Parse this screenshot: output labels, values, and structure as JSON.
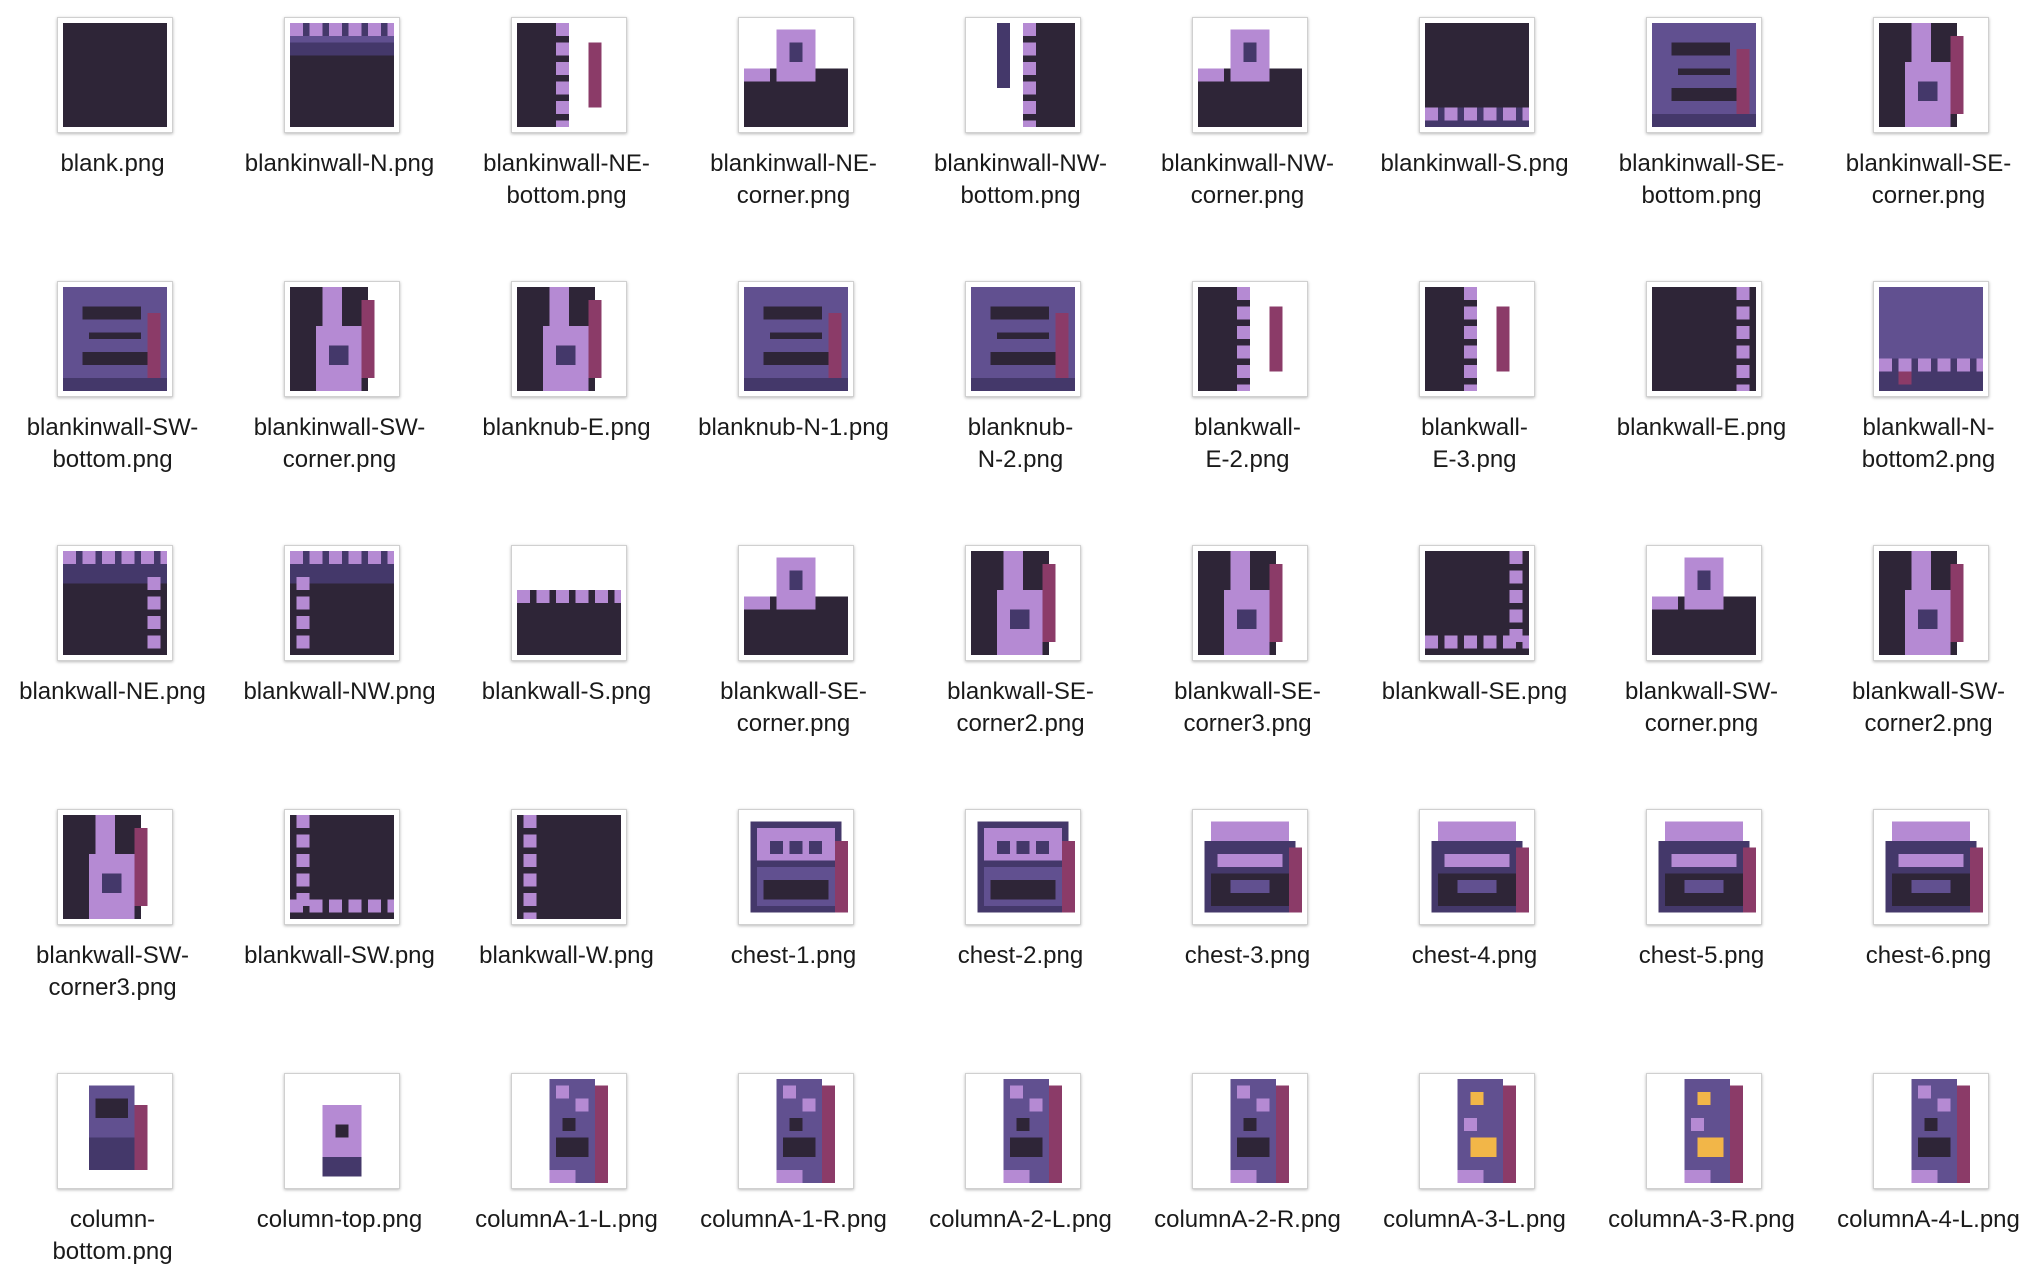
{
  "colors": {
    "dark": "#2e2537",
    "wall": "#615090",
    "wall_dark": "#44386a",
    "light": "#b58ad3",
    "accent": "#8b3b68",
    "gold": "#f2b648"
  },
  "files": [
    {
      "name": "blank.png",
      "label_lines": [
        "blank.png"
      ],
      "pattern": "dark"
    },
    {
      "name": "blankinwall-N.png",
      "label_lines": [
        "blankinwall-N.png"
      ],
      "pattern": "wall-top"
    },
    {
      "name": "blankinwall-NE-bottom.png",
      "label_lines": [
        "blankinwall-NE-",
        "bottom.png"
      ],
      "pattern": "wall-right-side"
    },
    {
      "name": "blankinwall-NE-corner.png",
      "label_lines": [
        "blankinwall-NE-",
        "corner.png"
      ],
      "pattern": "corner-nub"
    },
    {
      "name": "blankinwall-NW-bottom.png",
      "label_lines": [
        "blankinwall-NW-",
        "bottom.png"
      ],
      "pattern": "wall-left-side"
    },
    {
      "name": "blankinwall-NW-corner.png",
      "label_lines": [
        "blankinwall-NW-",
        "corner.png"
      ],
      "pattern": "corner-nub"
    },
    {
      "name": "blankinwall-S.png",
      "label_lines": [
        "blankinwall-S.png"
      ],
      "pattern": "wall-bottom"
    },
    {
      "name": "blankinwall-SE-bottom.png",
      "label_lines": [
        "blankinwall-SE-",
        "bottom.png"
      ],
      "pattern": "nub-block"
    },
    {
      "name": "blankinwall-SE-corner.png",
      "label_lines": [
        "blankinwall-SE-",
        "corner.png"
      ],
      "pattern": "column-piece"
    },
    {
      "name": "blankinwall-SW-bottom.png",
      "label_lines": [
        "blankinwall-SW-",
        "bottom.png"
      ],
      "pattern": "nub-block"
    },
    {
      "name": "blankinwall-SW-corner.png",
      "label_lines": [
        "blankinwall-SW-",
        "corner.png"
      ],
      "pattern": "column-piece"
    },
    {
      "name": "blanknub-E.png",
      "label_lines": [
        "blanknub-E.png"
      ],
      "pattern": "column-piece"
    },
    {
      "name": "blanknub-N-1.png",
      "label_lines": [
        "blanknub-N-1.png"
      ],
      "pattern": "nub-block"
    },
    {
      "name": "blanknub-N-2.png",
      "label_lines": [
        "blanknub-",
        "N-2.png"
      ],
      "pattern": "nub-block"
    },
    {
      "name": "blankwall-E-2.png",
      "label_lines": [
        "blankwall-",
        "E-2.png"
      ],
      "pattern": "wall-right-side"
    },
    {
      "name": "blankwall-E-3.png",
      "label_lines": [
        "blankwall-",
        "E-3.png"
      ],
      "pattern": "wall-right-side"
    },
    {
      "name": "blankwall-E.png",
      "label_lines": [
        "blankwall-E.png"
      ],
      "pattern": "wall-right"
    },
    {
      "name": "blankwall-N-bottom2.png",
      "label_lines": [
        "blankwall-N-",
        "bottom2.png"
      ],
      "pattern": "wall-block"
    },
    {
      "name": "blankwall-NE.png",
      "label_lines": [
        "blankwall-NE.png"
      ],
      "pattern": "wall-top-right"
    },
    {
      "name": "blankwall-NW.png",
      "label_lines": [
        "blankwall-NW.png"
      ],
      "pattern": "wall-top-left"
    },
    {
      "name": "blankwall-S.png",
      "label_lines": [
        "blankwall-S.png"
      ],
      "pattern": "wall-low"
    },
    {
      "name": "blankwall-SE-corner.png",
      "label_lines": [
        "blankwall-SE-",
        "corner.png"
      ],
      "pattern": "corner-nub"
    },
    {
      "name": "blankwall-SE-corner2.png",
      "label_lines": [
        "blankwall-SE-",
        "corner2.png"
      ],
      "pattern": "column-piece"
    },
    {
      "name": "blankwall-SE-corner3.png",
      "label_lines": [
        "blankwall-SE-",
        "corner3.png"
      ],
      "pattern": "column-piece"
    },
    {
      "name": "blankwall-SE.png",
      "label_lines": [
        "blankwall-SE.png"
      ],
      "pattern": "wall-bottom-right"
    },
    {
      "name": "blankwall-SW-corner.png",
      "label_lines": [
        "blankwall-SW-",
        "corner.png"
      ],
      "pattern": "corner-nub"
    },
    {
      "name": "blankwall-SW-corner2.png",
      "label_lines": [
        "blankwall-SW-",
        "corner2.png"
      ],
      "pattern": "column-piece"
    },
    {
      "name": "blankwall-SW-corner3.png",
      "label_lines": [
        "blankwall-SW-",
        "corner3.png"
      ],
      "pattern": "column-piece"
    },
    {
      "name": "blankwall-SW.png",
      "label_lines": [
        "blankwall-SW.png"
      ],
      "pattern": "wall-bottom-left"
    },
    {
      "name": "blankwall-W.png",
      "label_lines": [
        "blankwall-W.png"
      ],
      "pattern": "wall-left"
    },
    {
      "name": "chest-1.png",
      "label_lines": [
        "chest-1.png"
      ],
      "pattern": "chest"
    },
    {
      "name": "chest-2.png",
      "label_lines": [
        "chest-2.png"
      ],
      "pattern": "chest"
    },
    {
      "name": "chest-3.png",
      "label_lines": [
        "chest-3.png"
      ],
      "pattern": "chest-open"
    },
    {
      "name": "chest-4.png",
      "label_lines": [
        "chest-4.png"
      ],
      "pattern": "chest-open"
    },
    {
      "name": "chest-5.png",
      "label_lines": [
        "chest-5.png"
      ],
      "pattern": "chest-open"
    },
    {
      "name": "chest-6.png",
      "label_lines": [
        "chest-6.png"
      ],
      "pattern": "chest-open"
    },
    {
      "name": "column-bottom.png",
      "label_lines": [
        "column-",
        "bottom.png"
      ],
      "pattern": "column-bottom"
    },
    {
      "name": "column-top.png",
      "label_lines": [
        "column-top.png"
      ],
      "pattern": "column-top"
    },
    {
      "name": "columnA-1-L.png",
      "label_lines": [
        "columnA-1-L.png"
      ],
      "pattern": "pillar"
    },
    {
      "name": "columnA-1-R.png",
      "label_lines": [
        "columnA-1-R.png"
      ],
      "pattern": "pillar"
    },
    {
      "name": "columnA-2-L.png",
      "label_lines": [
        "columnA-2-L.png"
      ],
      "pattern": "pillar"
    },
    {
      "name": "columnA-2-R.png",
      "label_lines": [
        "columnA-2-R.png"
      ],
      "pattern": "pillar"
    },
    {
      "name": "columnA-3-L.png",
      "label_lines": [
        "columnA-3-L.png"
      ],
      "pattern": "pillar-gold"
    },
    {
      "name": "columnA-3-R.png",
      "label_lines": [
        "columnA-3-R.png"
      ],
      "pattern": "pillar-gold"
    },
    {
      "name": "columnA-4-L.png",
      "label_lines": [
        "columnA-4-L.png"
      ],
      "pattern": "pillar"
    }
  ]
}
